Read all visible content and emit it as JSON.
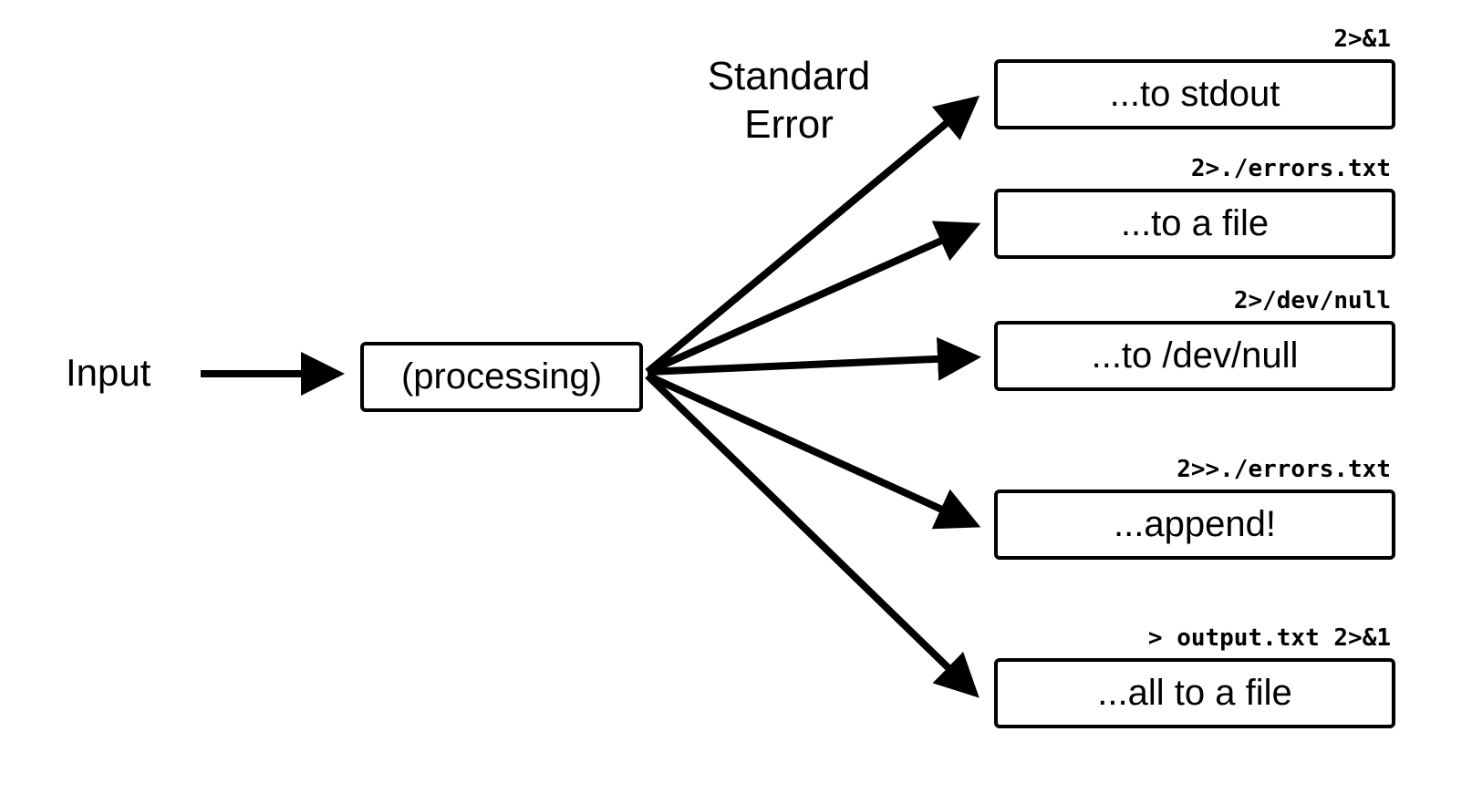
{
  "input_label": "Input",
  "processing_label": "(processing)",
  "heading": "Standard\nError",
  "targets": [
    {
      "label": "...to stdout",
      "hint": "2>&1"
    },
    {
      "label": "...to a file",
      "hint": "2>./errors.txt"
    },
    {
      "label": "...to /dev/null",
      "hint": "2>/dev/null"
    },
    {
      "label": "...append!",
      "hint": "2>>./errors.txt"
    },
    {
      "label": "...all to a file",
      "hint": "> output.txt 2>&1"
    }
  ]
}
